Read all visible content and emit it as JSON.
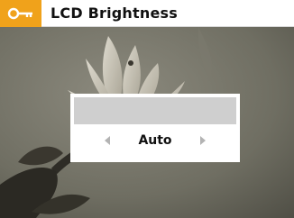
{
  "header": {
    "title": "LCD Brightness",
    "icon": "key-icon",
    "accent_color": "#f0a21b"
  },
  "setting": {
    "value": "Auto",
    "prev_icon": "arrow-left-icon",
    "next_icon": "arrow-right-icon"
  }
}
